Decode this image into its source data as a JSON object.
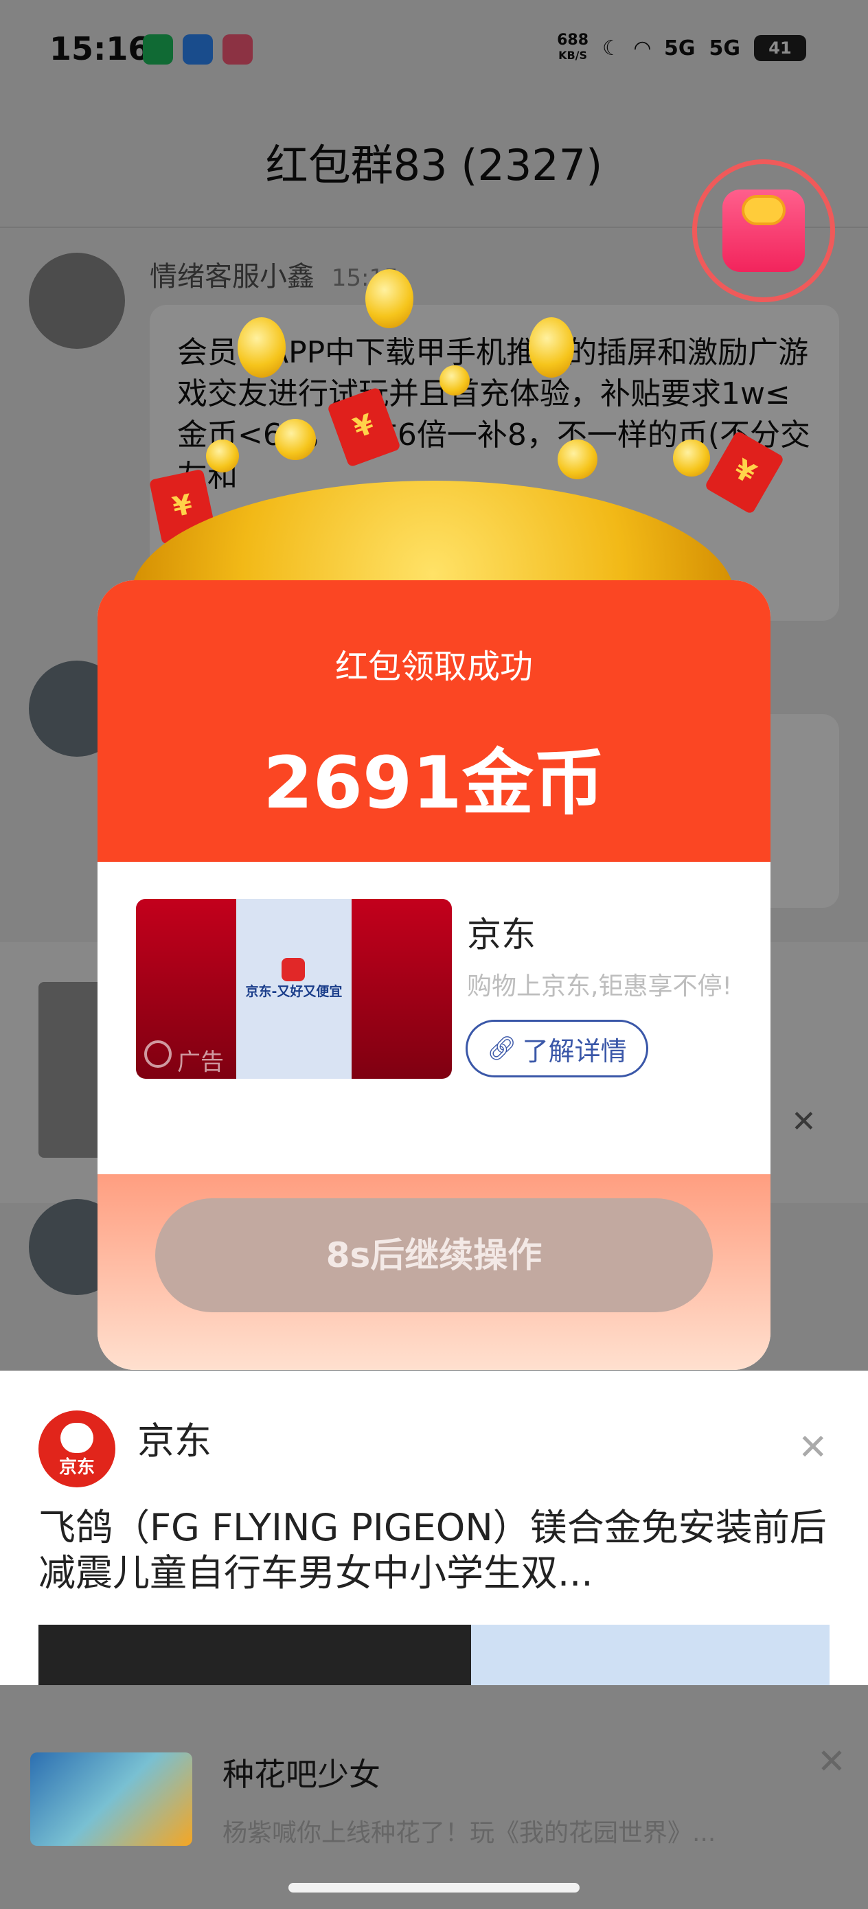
{
  "status_bar": {
    "time": "15:16",
    "net_speed": "688",
    "net_unit": "KB/S",
    "sim1": "5G",
    "sim2": "5G",
    "battery": "41"
  },
  "chat": {
    "title": "红包群83 (2327)",
    "messages": [
      {
        "sender": "情绪客服小鑫",
        "time": "15:15",
        "text": "会员在APP中下载甲手机推荐的插屏和激励广游戏交友进行试玩并且首充体验，补贴要求1w≤金币<6w，首充6倍一补8，不一样的币(不分交友和"
      }
    ]
  },
  "popup": {
    "label": "红包领取成功",
    "amount": "2691金币",
    "ad": {
      "brand": "京东",
      "slogan": "购物上京东,钜惠享不停!",
      "thumb_text": "京东-又好又便宜",
      "ad_tag": "广告",
      "detail_button": "了解详情"
    },
    "continue_button": "8s后继续操作"
  },
  "bottom_ad": {
    "brand": "京东",
    "logo_text": "京东",
    "title": "飞鸽（FG FLYING PIGEON）镁合金免安装前后减震儿童自行车男女中小学生双..."
  },
  "game_ad": {
    "name": "种花吧少女",
    "desc": "杨紫喊你上线种花了！玩《我的花园世界》..."
  },
  "colors": {
    "popup_red": "#fb4623",
    "button_disabled": "#c2a9a0",
    "link_blue": "#3a57a8",
    "jd_red": "#e1251b"
  }
}
